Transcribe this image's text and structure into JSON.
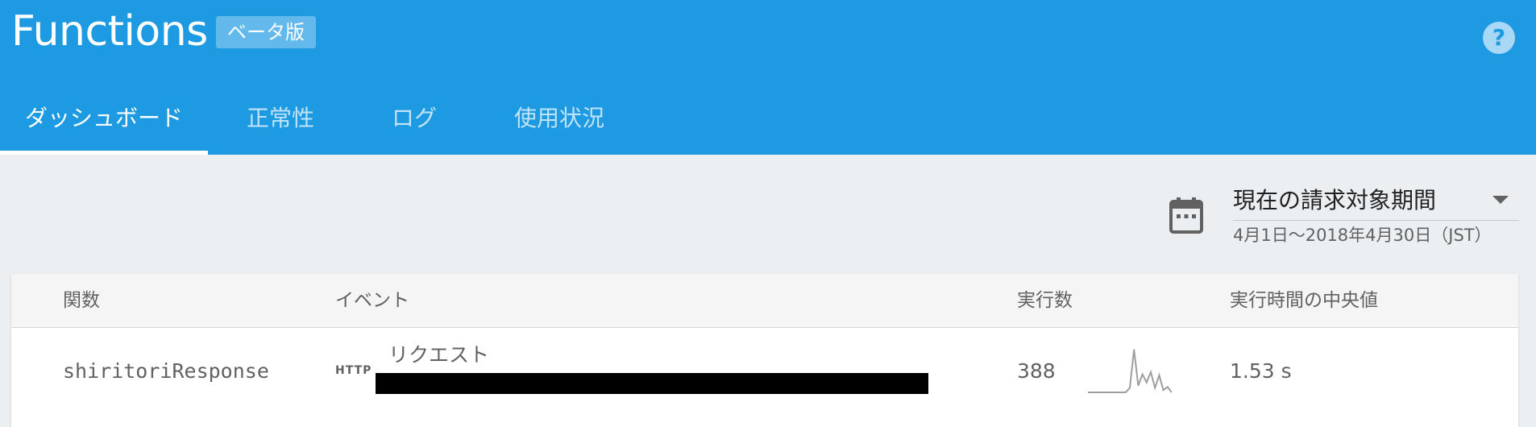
{
  "header": {
    "title": "Functions",
    "beta_badge": "ベータ版",
    "help_label": "?",
    "tabs": [
      {
        "label": "ダッシュボード",
        "active": true
      },
      {
        "label": "正常性",
        "active": false
      },
      {
        "label": "ログ",
        "active": false
      },
      {
        "label": "使用状況",
        "active": false
      }
    ]
  },
  "date_filter": {
    "label": "現在の請求対象期間",
    "range": "4月1日〜2018年4月30日（JST）",
    "icon": "calendar-icon"
  },
  "table": {
    "columns": [
      "関数",
      "イベント",
      "実行数",
      "実行時間の中央値"
    ],
    "rows": [
      {
        "function": "shiritoriResponse",
        "event_type": "HTTP",
        "event_label": "リクエスト",
        "executions": "388",
        "median_time": "1.53 s",
        "sparkline": [
          0,
          0,
          0,
          0,
          0,
          0,
          0,
          0,
          0,
          0,
          0.1,
          0.95,
          0.15,
          0.4,
          0.22,
          0.45,
          0.1,
          0.38,
          0.05,
          0.12,
          0
        ]
      }
    ]
  },
  "colors": {
    "header_bg": "#1e9ae2",
    "page_bg": "#eceff1",
    "badge_bg": "#63b8ec",
    "sparkline": "#9e9e9e"
  }
}
